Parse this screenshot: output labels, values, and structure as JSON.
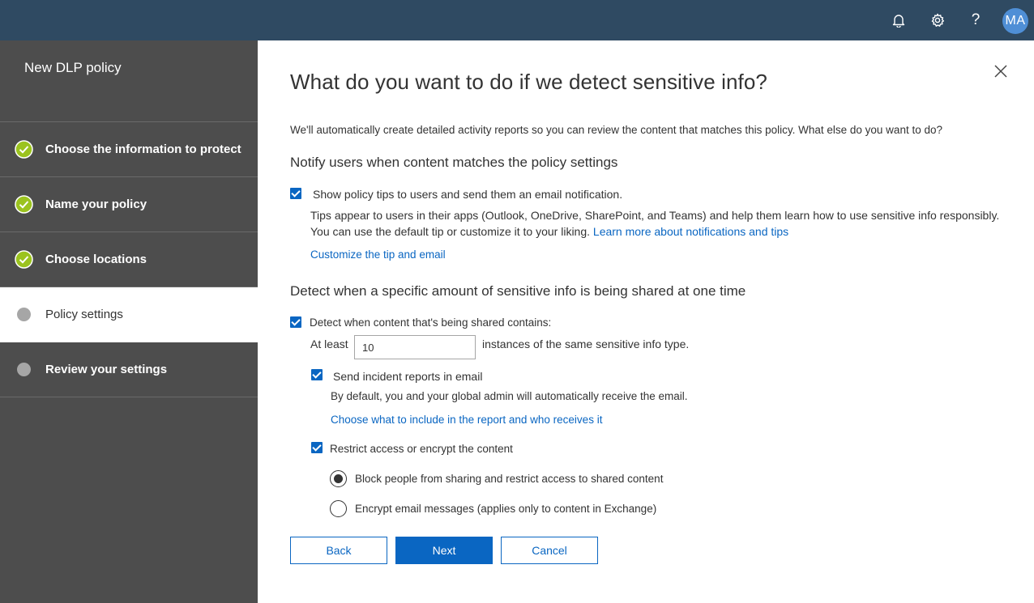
{
  "colors": {
    "topbar": "#2f4a62",
    "sidebar": "#4d4d4d",
    "accent": "#0a66c2",
    "check_green": "#9bc31f",
    "avatar": "#4f8fd6"
  },
  "header": {
    "icons": [
      "bell-icon",
      "gear-icon",
      "help-icon"
    ],
    "help_label": "?",
    "avatar_initials": "MA"
  },
  "sidebar": {
    "title": "New DLP policy",
    "steps": [
      {
        "label": "Choose the information to protect",
        "status": "complete"
      },
      {
        "label": "Name your policy",
        "status": "complete"
      },
      {
        "label": "Choose locations",
        "status": "complete"
      },
      {
        "label": "Policy settings",
        "status": "current"
      },
      {
        "label": "Review your settings",
        "status": "pending"
      }
    ]
  },
  "main": {
    "heading": "What do you want to do if we detect sensitive info?",
    "intro": "We'll automatically create detailed activity reports so you can review the content that matches this policy. What else do you want to do?",
    "notify": {
      "title": "Notify users when content matches the policy settings",
      "checkbox_label": "Show policy tips to users and send them an email notification.",
      "checked": true,
      "desc_line1": "Tips appear to users in their apps (Outlook, OneDrive, SharePoint, and Teams) and help them learn how to use sensitive info responsibly.",
      "desc_line2": "You can use the default tip or customize it to your liking.",
      "learn_more_link": "Learn more about notifications and tips",
      "customize_link": "Customize the tip and email"
    },
    "detect": {
      "title": "Detect when a specific amount of sensitive info is being shared at one time",
      "checkbox_label": "Detect when content that's being shared contains:",
      "checked": true,
      "at_least_label": "At least",
      "instances_value": "10",
      "instances_suffix": "instances of the same sensitive info type.",
      "incident": {
        "label": "Send incident reports in email",
        "checked": true,
        "desc": "By default, you and your global admin will automatically receive the email.",
        "link": "Choose what to include in the report and who receives it"
      },
      "restrict": {
        "label": "Restrict access or encrypt the content",
        "checked": true,
        "options": [
          {
            "label": "Block people from sharing and restrict access to shared content",
            "selected": true
          },
          {
            "label": "Encrypt email messages (applies only to content in Exchange)",
            "selected": false
          }
        ]
      }
    },
    "buttons": {
      "back": "Back",
      "next": "Next",
      "cancel": "Cancel"
    }
  }
}
